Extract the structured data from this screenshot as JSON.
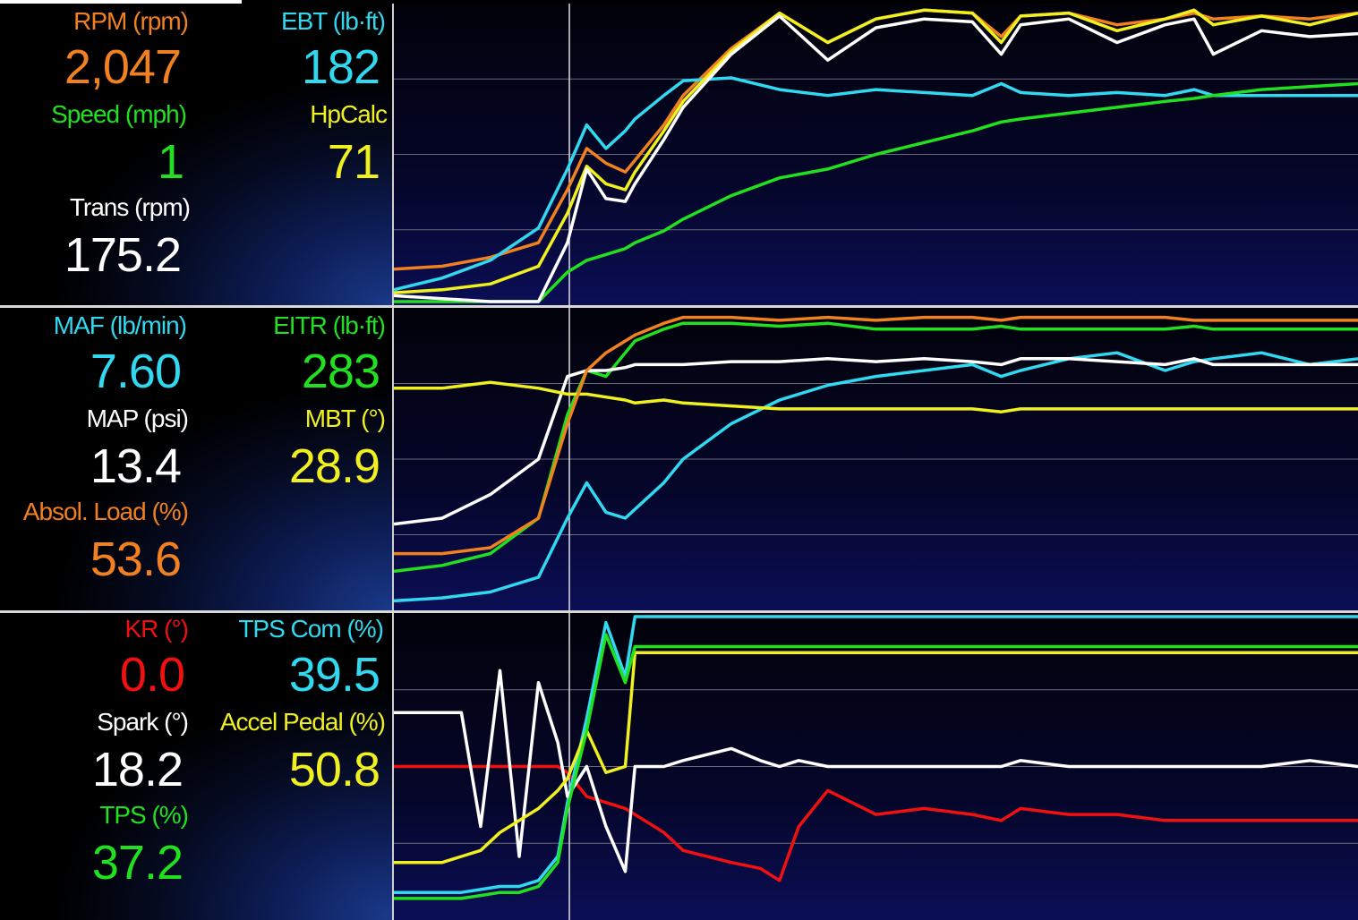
{
  "panels": [
    {
      "gauges": [
        {
          "label": "RPM (rpm)",
          "value": "2,047",
          "color": "#f08020"
        },
        {
          "label": "EBT (lb·ft)",
          "value": "182",
          "color": "#30d8f0"
        },
        {
          "label": "Speed (mph)",
          "value": "1",
          "color": "#20e020"
        },
        {
          "label": "HpCalc",
          "value": "71",
          "color": "#f0f020"
        },
        {
          "label": "Trans (rpm)",
          "value": "175.2",
          "color": "#ffffff"
        }
      ]
    },
    {
      "gauges": [
        {
          "label": "MAF (lb/min)",
          "value": "7.60",
          "color": "#30d8f0"
        },
        {
          "label": "EITR (lb·ft)",
          "value": "283",
          "color": "#20e020"
        },
        {
          "label": "MAP (psi)",
          "value": "13.4",
          "color": "#ffffff"
        },
        {
          "label": "MBT (°)",
          "value": "28.9",
          "color": "#f0f020"
        },
        {
          "label": "Absol. Load (%)",
          "value": "53.6",
          "color": "#f08020"
        }
      ]
    },
    {
      "gauges": [
        {
          "label": "KR (°)",
          "value": "0.0",
          "color": "#f01010"
        },
        {
          "label": "TPS Com (%)",
          "value": "39.5",
          "color": "#30d8f0"
        },
        {
          "label": "Spark (°)",
          "value": "18.2",
          "color": "#ffffff"
        },
        {
          "label": "Accel Pedal (%)",
          "value": "50.8",
          "color": "#f0f020"
        },
        {
          "label": "TPS (%)",
          "value": "37.2",
          "color": "#20e020"
        }
      ]
    }
  ],
  "chart_data": [
    {
      "type": "line",
      "x": [
        0,
        5,
        10,
        15,
        18,
        20,
        22,
        24,
        25,
        28,
        30,
        35,
        40,
        45,
        50,
        55,
        60,
        63,
        65,
        70,
        75,
        80,
        83,
        85,
        90,
        95,
        100
      ],
      "series": [
        {
          "name": "RPM",
          "color": "#f08020",
          "values": [
            11,
            12,
            15,
            20,
            38,
            52,
            47,
            44,
            48,
            60,
            70,
            86,
            98,
            88,
            96,
            99,
            98,
            90,
            97,
            98,
            94,
            96,
            98,
            96,
            97,
            96,
            98
          ]
        },
        {
          "name": "EBT",
          "color": "#30d8f0",
          "values": [
            4,
            8,
            14,
            25,
            45,
            60,
            52,
            58,
            62,
            70,
            75,
            76,
            72,
            70,
            72,
            71,
            70,
            74,
            71,
            70,
            71,
            70,
            72,
            70,
            70,
            70,
            70
          ]
        },
        {
          "name": "Speed",
          "color": "#20e020",
          "values": [
            0,
            0,
            0,
            0,
            10,
            14,
            16,
            18,
            20,
            24,
            28,
            36,
            42,
            45,
            50,
            54,
            58,
            61,
            62,
            64,
            66,
            68,
            69,
            70,
            72,
            73,
            74
          ]
        },
        {
          "name": "HpCalc",
          "color": "#f0f020",
          "values": [
            3,
            4,
            6,
            12,
            30,
            46,
            40,
            38,
            44,
            58,
            68,
            85,
            98,
            88,
            96,
            99,
            98,
            88,
            97,
            98,
            92,
            96,
            99,
            94,
            97,
            94,
            98
          ]
        },
        {
          "name": "Trans",
          "color": "#ffffff",
          "values": [
            2,
            1,
            0,
            0,
            20,
            45,
            35,
            34,
            40,
            55,
            66,
            84,
            97,
            82,
            93,
            96,
            95,
            84,
            94,
            96,
            88,
            94,
            96,
            84,
            92,
            90,
            91
          ]
        }
      ]
    },
    {
      "type": "line",
      "x": [
        0,
        5,
        10,
        15,
        18,
        20,
        22,
        24,
        25,
        28,
        30,
        35,
        40,
        45,
        50,
        55,
        60,
        63,
        65,
        70,
        75,
        80,
        83,
        85,
        90,
        95,
        100
      ],
      "series": [
        {
          "name": "MAF",
          "color": "#30d8f0",
          "values": [
            2,
            3,
            5,
            10,
            30,
            42,
            32,
            30,
            33,
            42,
            50,
            62,
            70,
            75,
            78,
            80,
            82,
            78,
            80,
            84,
            86,
            80,
            83,
            84,
            86,
            82,
            84
          ]
        },
        {
          "name": "EITR",
          "color": "#20e020",
          "values": [
            12,
            14,
            18,
            30,
            65,
            80,
            78,
            86,
            90,
            94,
            96,
            96,
            95,
            96,
            94,
            94,
            94,
            95,
            94,
            94,
            94,
            94,
            95,
            94,
            94,
            94,
            94
          ]
        },
        {
          "name": "MAP",
          "color": "#ffffff",
          "values": [
            28,
            30,
            38,
            50,
            78,
            80,
            80,
            81,
            82,
            82,
            82,
            83,
            83,
            84,
            83,
            84,
            83,
            82,
            84,
            84,
            83,
            82,
            84,
            82,
            82,
            82,
            82
          ]
        },
        {
          "name": "MBT",
          "color": "#f0f020",
          "values": [
            74,
            74,
            76,
            74,
            72,
            72,
            71,
            70,
            69,
            70,
            69,
            68,
            67,
            67,
            67,
            67,
            67,
            66,
            67,
            67,
            67,
            67,
            67,
            67,
            67,
            67,
            67
          ]
        },
        {
          "name": "Absol. Load",
          "color": "#f08020",
          "values": [
            18,
            18,
            20,
            30,
            62,
            80,
            86,
            90,
            92,
            96,
            98,
            98,
            97,
            98,
            97,
            98,
            98,
            97,
            98,
            98,
            98,
            98,
            97,
            97,
            97,
            97,
            97
          ]
        }
      ]
    },
    {
      "type": "line",
      "x": [
        0,
        5,
        7,
        9,
        11,
        13,
        15,
        17,
        18,
        20,
        22,
        24,
        25,
        28,
        30,
        35,
        38,
        40,
        42,
        45,
        50,
        55,
        60,
        63,
        65,
        70,
        75,
        80,
        85,
        90,
        95,
        100
      ],
      "series": [
        {
          "name": "KR",
          "color": "#f01010",
          "values": [
            50,
            50,
            50,
            50,
            50,
            50,
            50,
            50,
            48,
            40,
            38,
            36,
            34,
            28,
            22,
            18,
            16,
            12,
            30,
            42,
            34,
            36,
            34,
            32,
            36,
            34,
            34,
            32,
            32,
            32,
            32,
            32
          ]
        },
        {
          "name": "TPS Com",
          "color": "#30d8f0",
          "values": [
            8,
            8,
            8,
            9,
            10,
            10,
            12,
            20,
            38,
            66,
            98,
            80,
            100,
            100,
            100,
            100,
            100,
            100,
            100,
            100,
            100,
            100,
            100,
            100,
            100,
            100,
            100,
            100,
            100,
            100,
            100,
            100
          ]
        },
        {
          "name": "Spark",
          "color": "#ffffff",
          "values": [
            68,
            68,
            68,
            30,
            82,
            20,
            78,
            58,
            40,
            50,
            30,
            15,
            50,
            50,
            52,
            56,
            52,
            50,
            52,
            50,
            50,
            50,
            50,
            50,
            52,
            50,
            50,
            50,
            50,
            50,
            52,
            50
          ]
        },
        {
          "name": "Accel Pedal",
          "color": "#f0f020",
          "values": [
            18,
            18,
            20,
            22,
            28,
            32,
            36,
            42,
            46,
            62,
            48,
            50,
            88,
            88,
            88,
            88,
            88,
            88,
            88,
            88,
            88,
            88,
            88,
            88,
            88,
            88,
            88,
            88,
            88,
            88,
            88,
            88
          ]
        },
        {
          "name": "TPS",
          "color": "#20e020",
          "values": [
            6,
            6,
            6,
            7,
            8,
            8,
            10,
            18,
            36,
            62,
            94,
            78,
            90,
            90,
            90,
            90,
            90,
            90,
            90,
            90,
            90,
            90,
            90,
            90,
            90,
            90,
            90,
            90,
            90,
            90,
            90,
            90
          ]
        }
      ]
    }
  ]
}
